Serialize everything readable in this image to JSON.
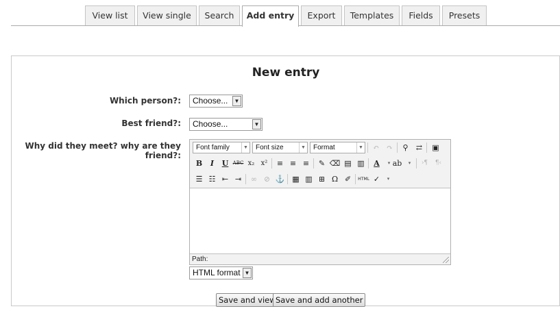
{
  "tabs": [
    "View list",
    "View single",
    "Search",
    "Add entry",
    "Export",
    "Templates",
    "Fields",
    "Presets"
  ],
  "active_tab": "Add entry",
  "form": {
    "title": "New entry",
    "which_person": {
      "label": "Which person?:",
      "value": "Choose..."
    },
    "best_friend": {
      "label": "Best friend?:",
      "value": "Choose..."
    },
    "why_met": {
      "label": "Why did they meet? why are they friend?:"
    }
  },
  "editor": {
    "font_family": "Font family",
    "font_size": "Font size",
    "format": "Format",
    "path_label": "Path:",
    "format_select": "HTML format"
  },
  "buttons": {
    "save_view": "Save and view",
    "save_add": "Save and add another"
  }
}
